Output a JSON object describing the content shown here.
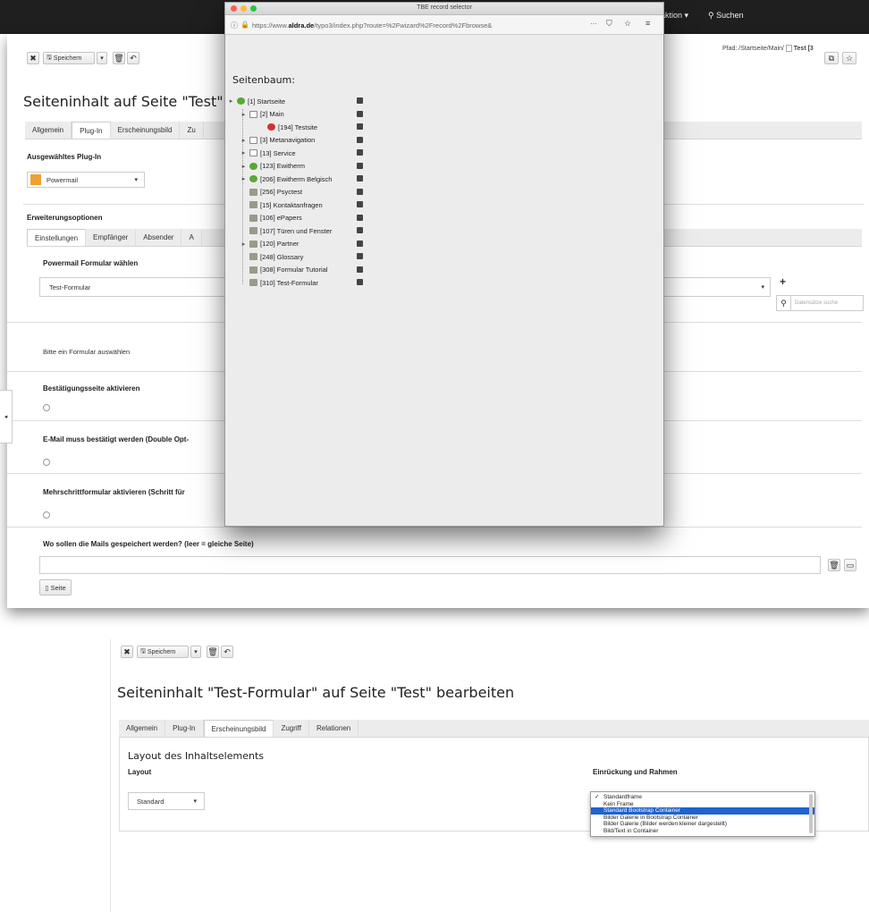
{
  "topbar": {
    "user_label": "HOCHZWEI Redaktion",
    "search_label": "Suchen"
  },
  "shot1": {
    "path_label": "Pfad: /Startseite/Main/",
    "path_page": "Test [3",
    "save_label": "Speichern",
    "heading": "Seiteninhalt auf Seite \"Test\" b",
    "tabs": [
      "Allgemein",
      "Plug-In",
      "Erscheinungsbild",
      "Zu"
    ],
    "plugin_label": "Ausgewähltes Plug-In",
    "plugin_value": "Powermail",
    "ext_label": "Erweiterungsoptionen",
    "subtabs": [
      "Einstellungen",
      "Empfänger",
      "Absender",
      "A"
    ],
    "form_label": "Powermail Formular wählen",
    "form_value": "Test-Formular",
    "search_placeholder": "Datensätze suche",
    "hint": "Bitte ein Formular auswählen",
    "confirm_label": "Bestätigungsseite aktivieren",
    "optin_label": "E-Mail muss bestätigt werden (Double Opt-",
    "multistep_label": "Mehrschrittformular aktivieren (Schritt für",
    "storage_label": "Wo sollen die Mails gespeichert werden? (leer = gleiche Seite)",
    "page_button": "Seite"
  },
  "popup": {
    "window_title": "TBE record selector",
    "url_prefix": "https://www.",
    "url_domain": "aldra.de",
    "url_rest": "/typo3/index.php?route=%2Fwizard%2Frecord%2Fbrowse&",
    "url_more": "···",
    "tree_title": "Seitenbaum:",
    "tree": [
      {
        "label": "[1] Startseite"
      },
      {
        "label": "[2] Main"
      },
      {
        "label": "[194] Testsite"
      },
      {
        "label": "[3] Metanavigation"
      },
      {
        "label": "[13] Service"
      },
      {
        "label": "[123] Ewitherm"
      },
      {
        "label": "[206] Ewitherm Belgisch"
      },
      {
        "label": "[256] Psyctest"
      },
      {
        "label": "[15] Kontaktanfragen"
      },
      {
        "label": "[106] ePapers"
      },
      {
        "label": "[107] Türen und Fenster"
      },
      {
        "label": "[120] Partner"
      },
      {
        "label": "[248] Glossary"
      },
      {
        "label": "[308] Formular Tutorial"
      },
      {
        "label": "[310] Test-Formular"
      }
    ]
  },
  "shot2": {
    "save_label": "Speichern",
    "heading": "Seiteninhalt \"Test-Formular\" auf Seite \"Test\" bearbeiten",
    "tabs": [
      "Allgemein",
      "Plug-In",
      "Erscheinungsbild",
      "Zugriff",
      "Relationen"
    ],
    "section_title": "Layout des Inhaltselements",
    "layout_label": "Layout",
    "layout_value": "Standard",
    "frame_label": "Einrückung und Rahmen",
    "frame_options": [
      "Standardframe",
      "Kein Frame",
      "Standard Bootstrap Container",
      "Bilder Galerie in Bootstrap Container",
      "Bilder Galerie (Bilder werden kleiner dargestellt)",
      "Bild/Text in Container"
    ],
    "frame_checked_index": 0,
    "frame_highlight_index": 2
  },
  "colors": {
    "accent": "#1f63d0",
    "topbar": "#1f1f1f",
    "plugin_icon": "#f0a030",
    "page_green": "#5aa832",
    "page_red": "#d63030"
  }
}
